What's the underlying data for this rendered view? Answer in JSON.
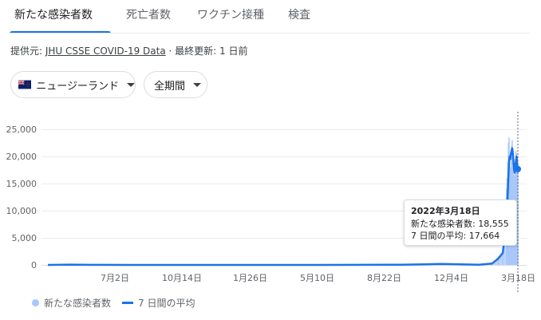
{
  "tabs": [
    {
      "label": "新たな感染者数",
      "active": true
    },
    {
      "label": "死亡者数",
      "active": false
    },
    {
      "label": "ワクチン接種",
      "active": false
    },
    {
      "label": "検査",
      "active": false
    }
  ],
  "source": {
    "prefix": "提供元: ",
    "link": "JHU CSSE COVID-19 Data",
    "suffix": " · 最終更新: 1 日前"
  },
  "filters": {
    "region": {
      "label": "ニュージーランド",
      "flag_icon": "new-zealand-flag-icon"
    },
    "period": {
      "label": "全期間"
    }
  },
  "colors": {
    "accent": "#1a73e8",
    "bars": "#a8c7fa",
    "grid": "#ececec"
  },
  "tooltip": {
    "date": "2022年3月18日",
    "new_cases_label": "新たな感染者数: 18,555",
    "avg_label": "7 日間の平均: 17,664"
  },
  "legend": {
    "cases": "新たな感染者数",
    "average": "7 日間の平均"
  },
  "chart_data": {
    "type": "area",
    "ylim": [
      0,
      25000
    ],
    "ytick_labels": [
      "25,000",
      "20,000",
      "15,000",
      "10,000",
      "5,000",
      "0"
    ],
    "yticks": [
      25000,
      20000,
      15000,
      10000,
      5000,
      0
    ],
    "xtick_labels": [
      "7月2日",
      "10月14日",
      "1月26日",
      "5月10日",
      "8月22日",
      "12月4日",
      "3月18日"
    ],
    "grid": true,
    "legend_position": "bottom-left",
    "series": [
      {
        "name": "新たな感染者数",
        "x": [
          "2020-03-01",
          "2020-04-05",
          "2020-05-10",
          "2020-07-02",
          "2020-10-14",
          "2021-01-26",
          "2021-05-10",
          "2021-08-22",
          "2021-09-15",
          "2021-10-20",
          "2021-11-15",
          "2021-12-04",
          "2022-01-15",
          "2022-02-05",
          "2022-02-15",
          "2022-02-22",
          "2022-02-28",
          "2022-03-01",
          "2022-03-02",
          "2022-03-03",
          "2022-03-04",
          "2022-03-05",
          "2022-03-06",
          "2022-03-07",
          "2022-03-08",
          "2022-03-09",
          "2022-03-10",
          "2022-03-11",
          "2022-03-12",
          "2022-03-13",
          "2022-03-14",
          "2022-03-15",
          "2022-03-16",
          "2022-03-17",
          "2022-03-18"
        ],
        "values": [
          0,
          90,
          5,
          2,
          5,
          8,
          4,
          30,
          60,
          120,
          200,
          150,
          60,
          300,
          1500,
          2500,
          14000,
          16000,
          19000,
          22500,
          23500,
          20000,
          14500,
          18000,
          22000,
          23000,
          21500,
          21000,
          16500,
          15000,
          19500,
          21000,
          20500,
          19000,
          18555
        ]
      },
      {
        "name": "7 日間の平均",
        "x": [
          "2020-03-01",
          "2020-04-05",
          "2020-05-10",
          "2020-07-02",
          "2020-10-14",
          "2021-01-26",
          "2021-05-10",
          "2021-08-22",
          "2021-09-15",
          "2021-10-20",
          "2021-11-15",
          "2021-12-04",
          "2022-01-15",
          "2022-02-05",
          "2022-02-15",
          "2022-02-22",
          "2022-02-28",
          "2022-03-01",
          "2022-03-02",
          "2022-03-03",
          "2022-03-04",
          "2022-03-05",
          "2022-03-06",
          "2022-03-07",
          "2022-03-08",
          "2022-03-09",
          "2022-03-10",
          "2022-03-11",
          "2022-03-12",
          "2022-03-13",
          "2022-03-14",
          "2022-03-15",
          "2022-03-16",
          "2022-03-17",
          "2022-03-18"
        ],
        "values": [
          0,
          60,
          8,
          2,
          4,
          6,
          3,
          25,
          50,
          110,
          180,
          140,
          50,
          250,
          1200,
          2200,
          8000,
          10500,
          13500,
          16500,
          19000,
          20000,
          19500,
          20500,
          21000,
          21500,
          20500,
          19000,
          17500,
          17000,
          18500,
          19000,
          20000,
          18500,
          17664
        ]
      }
    ]
  }
}
